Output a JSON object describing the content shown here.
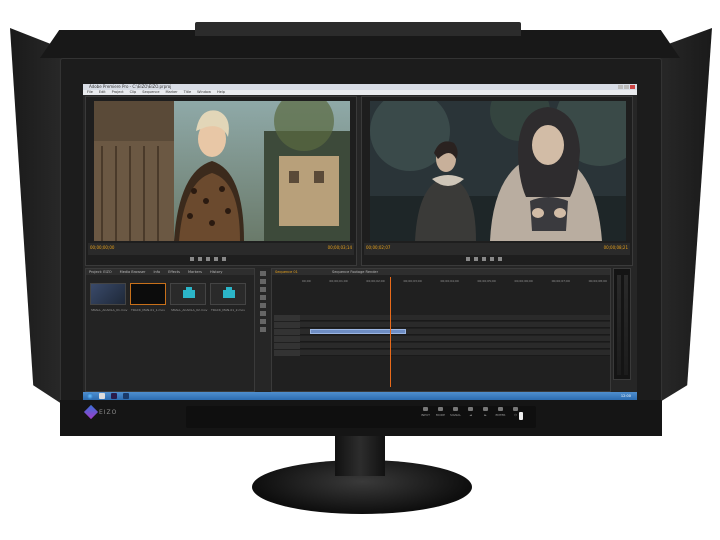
{
  "app": {
    "title": "Adobe Premiere Pro - C:\\EIZO\\EIZO.prproj",
    "menu": [
      "File",
      "Edit",
      "Project",
      "Clip",
      "Sequence",
      "Marker",
      "Title",
      "Window",
      "Help"
    ]
  },
  "source_monitor": {
    "timecode_in": "00;00;00;00",
    "timecode_out": "00;00;03;14"
  },
  "program_monitor": {
    "timecode_in": "00;00;02;07",
    "timecode_out": "00;00;08;21"
  },
  "project_panel": {
    "tabs": [
      "Project: EIZO",
      "Media Browser",
      "Info",
      "Effects",
      "Markers",
      "History"
    ],
    "items": [
      {
        "label": "SMALL_ACADLA_01.mov"
      },
      {
        "label": "TRACK_MAN-01_1.mov"
      },
      {
        "label": "SMALL_ACADLA_02.mov"
      },
      {
        "label": "TRACK_MAN-01_2.mov"
      }
    ]
  },
  "timeline": {
    "tabs": [
      "Sequence 01",
      "Sequence Footage Render"
    ],
    "ruler": [
      "00;00",
      "00;00;01;00",
      "00;00;02;00",
      "00;00;03;00",
      "00;00;04;00",
      "00;00;05;00",
      "00;00;06;00",
      "00;00;07;00",
      "00;00;08;00"
    ],
    "tracks": [
      "V3",
      "V2",
      "V1",
      "A1",
      "A2",
      "A3"
    ]
  },
  "monitor": {
    "brand": "EIZO",
    "controls": [
      "INPUT",
      "MODE",
      "SIGNAL",
      "◄",
      "►",
      "ENTER",
      "⏻"
    ]
  },
  "taskbar": {
    "clock": "12:00"
  },
  "colors": {
    "timecode": "#e8a21b",
    "playhead": "#e86a1a",
    "clip": "#6f8ec4",
    "taskbar": "#2c6cb0"
  }
}
